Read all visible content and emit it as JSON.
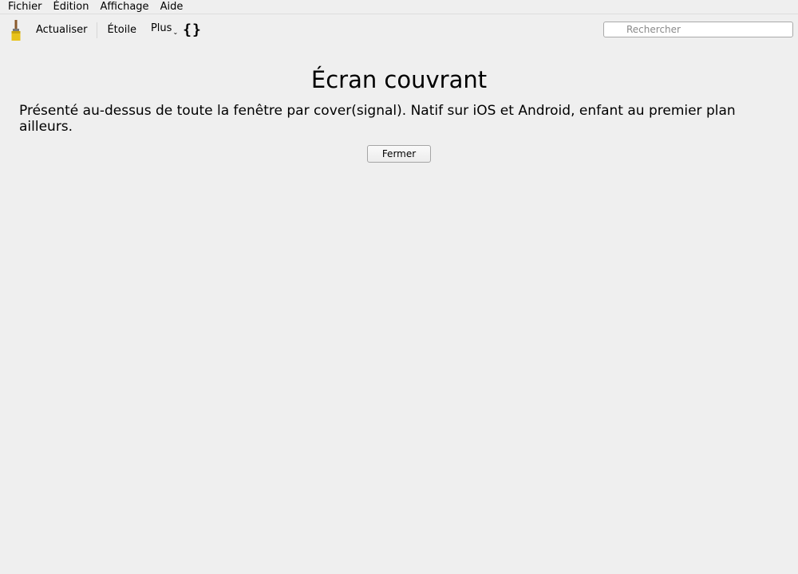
{
  "menubar": {
    "items": [
      {
        "label": "Fichier"
      },
      {
        "label": "Édition"
      },
      {
        "label": "Affichage"
      },
      {
        "label": "Aide"
      }
    ]
  },
  "toolbar": {
    "app_icon": "paintbrush-icon",
    "actualiser_label": "Actualiser",
    "etoile_label": "Étoile",
    "plus_label": "Plus",
    "plus_arrow": "⌄",
    "braces_icon": "braces-icon",
    "braces_glyph": "{}"
  },
  "search": {
    "placeholder": "Rechercher",
    "value": ""
  },
  "main": {
    "title": "Écran couvrant",
    "description": "Présenté au-dessus de toute la fenêtre par cover(signal). Natif sur iOS et Android, enfant au premier plan ailleurs.",
    "close_label": "Fermer"
  }
}
